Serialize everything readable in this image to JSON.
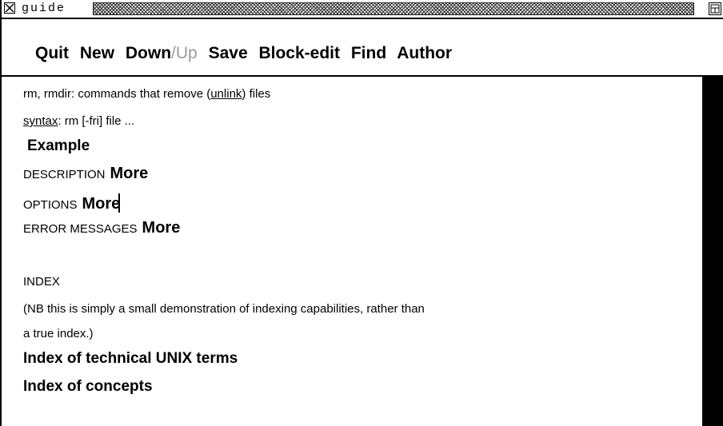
{
  "window": {
    "title": "guide"
  },
  "menu": {
    "quit": "Quit",
    "new": "New",
    "down": "Down",
    "slash": "/",
    "up": "Up",
    "save": "Save",
    "block_edit": "Block-edit",
    "find": "Find",
    "author": "Author"
  },
  "content": {
    "heading_prefix": "rm, rmdir: commands that remove (",
    "heading_link": "unlink",
    "heading_suffix": ") files",
    "syntax_label": "syntax",
    "syntax_text": ":  rm [-fri] file ...",
    "example": "Example",
    "description_label": "DESCRIPTION",
    "description_more": "More",
    "options_label": "OPTIONS",
    "options_more": "More",
    "errors_label": "ERROR MESSAGES",
    "errors_more": "More",
    "index_label": "INDEX",
    "index_note_1": "(NB this is simply a small demonstration of indexing capabilities, rather than",
    "index_note_2": "a true index.)",
    "index_technical": "Index of technical UNIX terms",
    "index_concepts": "Index of concepts"
  },
  "icons": {
    "close": "close-box-icon",
    "resize": "resize-box-icon"
  }
}
